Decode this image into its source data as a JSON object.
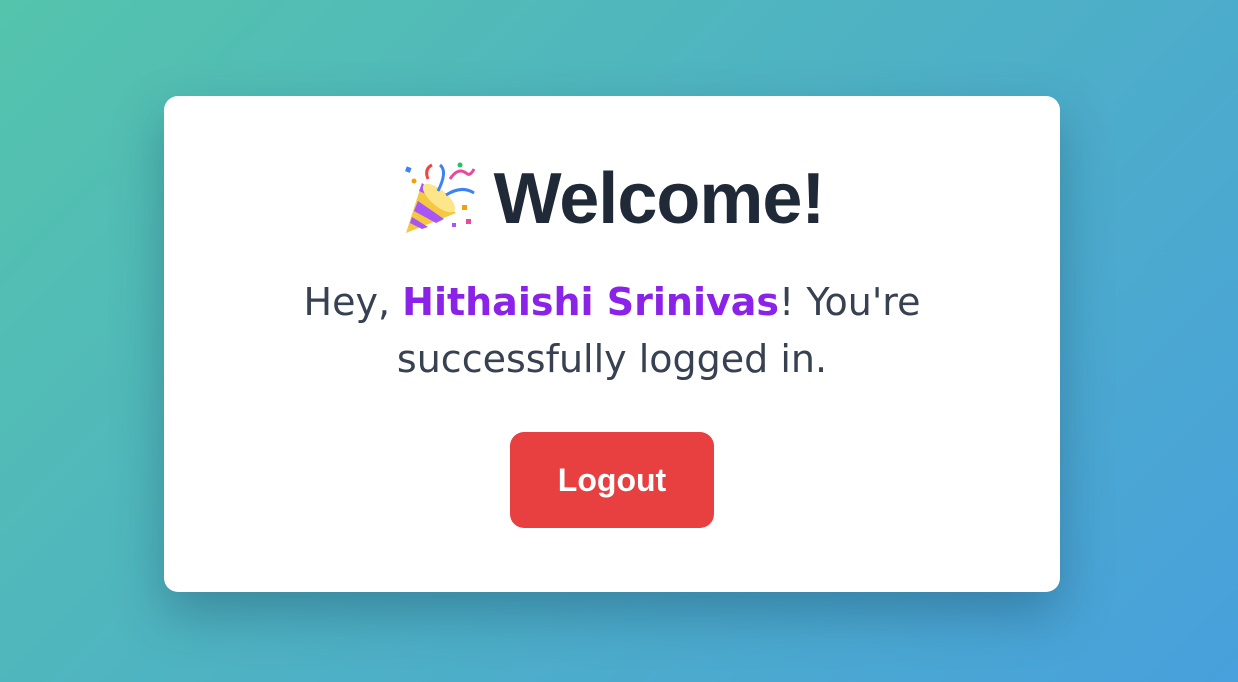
{
  "card": {
    "title": "Welcome!",
    "title_icon": "party-popper-icon",
    "greeting_prefix": "Hey, ",
    "user_name": "Hithaishi Srinivas",
    "greeting_suffix": "! You're successfully logged in.",
    "logout_label": "Logout"
  },
  "colors": {
    "accent_name": "#8b22e8",
    "logout_button": "#e84040",
    "title_text": "#1f2937",
    "body_text": "#374151"
  }
}
